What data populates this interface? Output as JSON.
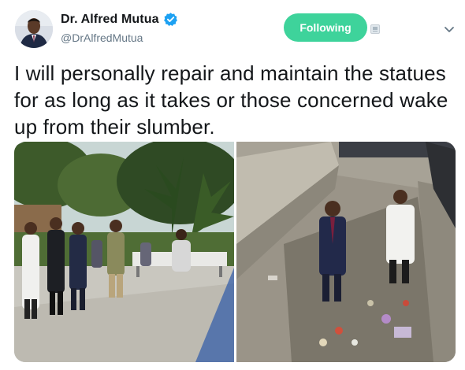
{
  "author": {
    "display_name": "Dr. Alfred Mutua",
    "handle": "@DrAlfredMutua",
    "verified": true,
    "avatar_icon": "profile-photo"
  },
  "actions": {
    "follow_label": "Following",
    "block_icon": "block-icon",
    "menu_icon": "chevron-down-icon"
  },
  "tweet": {
    "text": "I will personally repair and maintain the statues for as long as it takes or those concerned wake up from their slumber."
  },
  "colors": {
    "follow_button": "#3ed39b",
    "verified_badge": "#1da1f2",
    "handle": "#657786"
  }
}
